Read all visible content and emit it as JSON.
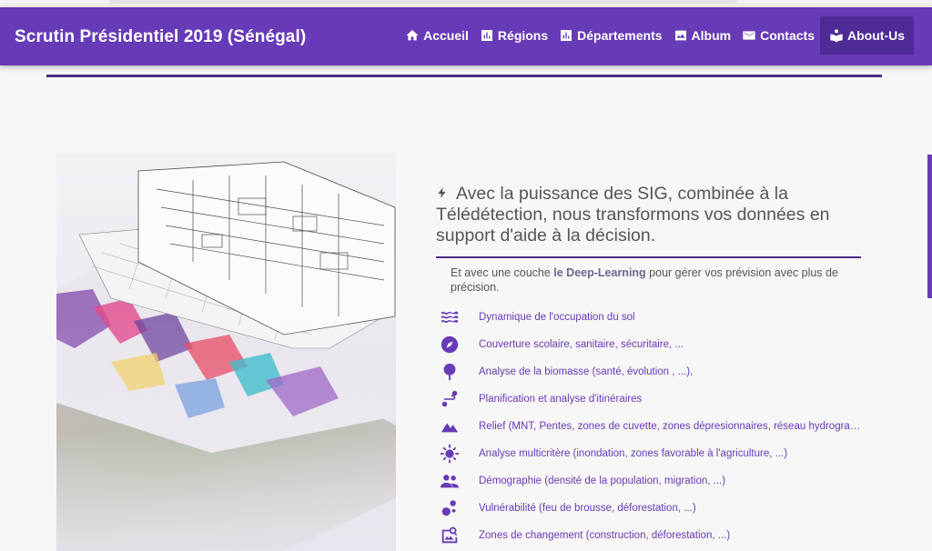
{
  "brand": "Scrutin Présidentiel 2019 (Sénégal)",
  "nav": [
    {
      "label": "Accueil",
      "icon": "home-icon"
    },
    {
      "label": "Régions",
      "icon": "bar-chart-icon"
    },
    {
      "label": "Départements",
      "icon": "bar-chart-icon"
    },
    {
      "label": "Album",
      "icon": "image-icon"
    },
    {
      "label": "Contacts",
      "icon": "envelope-icon"
    },
    {
      "label": "About-Us",
      "icon": "book-reader-icon",
      "active": true
    }
  ],
  "headline": "Avec la puissance des SIG, combinée à la Télédétection, nous transformons vos données en support d'aide à la décision.",
  "sub": {
    "before": "Et avec une couche ",
    "highlight": "le Deep-Learning",
    "after": " pour gérer vos prévision avec plus de précision."
  },
  "features": [
    {
      "icon": "waves-icon",
      "text": "Dynamique de l'occupation du sol"
    },
    {
      "icon": "compass-icon",
      "text": "Couverture scolaire, sanitaire, sécuritaire, ..."
    },
    {
      "icon": "tree-icon",
      "text": "Analyse de la biomasse (santé, évolution , ...),"
    },
    {
      "icon": "route-icon",
      "text": "Planification et analyse d'itinéraires"
    },
    {
      "icon": "mountain-icon",
      "text": "Relief (MNT, Pentes, zones de cuvette, zones dépresionnaires, réseau hydrographique, ...)"
    },
    {
      "icon": "sun-icon",
      "text": "Analyse multicritère (inondation, zones favorable à l'agriculture, ...)"
    },
    {
      "icon": "people-icon",
      "text": "Démographie (densité de la population, migration, ...)"
    },
    {
      "icon": "bubbles-icon",
      "text": "Vulnérabilité (feu de brousse, déforestation, ...)"
    },
    {
      "icon": "image-search-icon",
      "text": "Zones de changement (construction, déforestation, ...)"
    }
  ],
  "colors": {
    "primary": "#673ab7",
    "active": "#4f2b95",
    "rule": "#4a2c86"
  }
}
